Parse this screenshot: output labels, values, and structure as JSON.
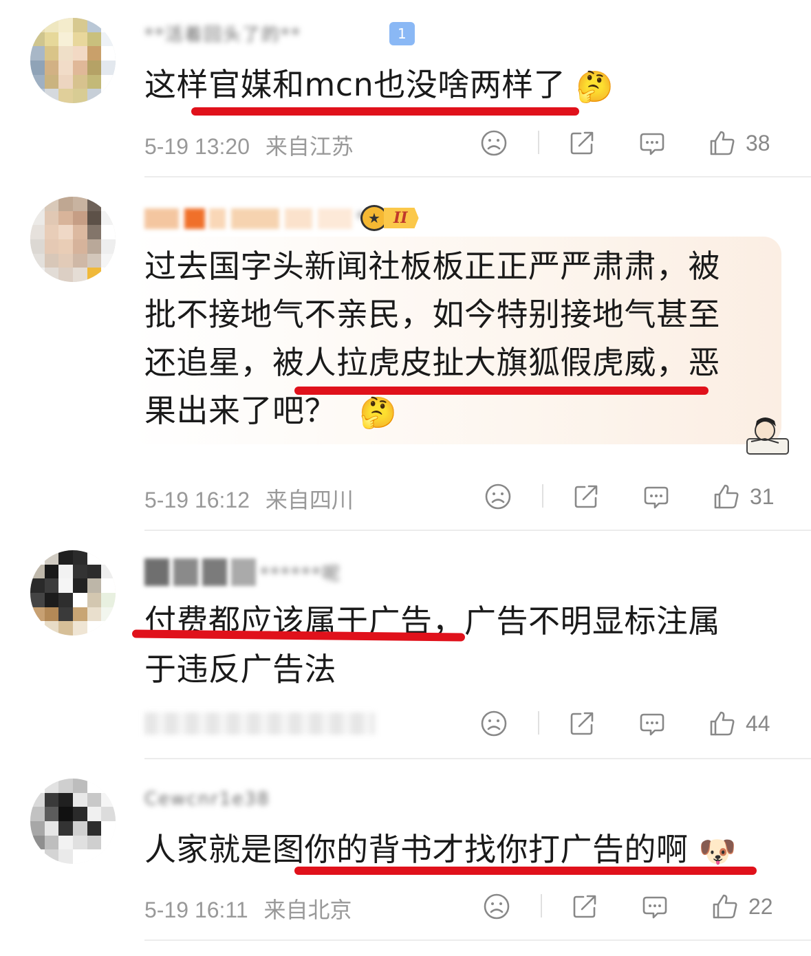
{
  "comments": [
    {
      "username": "**活着回头了的**",
      "level_badge": "1",
      "text_lines": [
        "这样官媒和mcn也没啥两样了"
      ],
      "emoji": "🤔",
      "time": "5-19 13:20",
      "location": "来自江苏",
      "likes": "38"
    },
    {
      "username": "****",
      "vip_badge": "II",
      "text_lines": [
        "过去国字头新闻社板板正正严严肃肃，被",
        "批不接地气不亲民，如今特别接地气甚至",
        "还追星，被人拉虎皮扯大旗狐假虎威，恶",
        "果出来了吧？"
      ],
      "emoji": "🤔",
      "time": "5-19 16:12",
      "location": "来自四川",
      "likes": "31"
    },
    {
      "username": "******呢",
      "text_lines": [
        "付费都应该属于广告，广告不明显标注属",
        "于违反广告法"
      ],
      "time": "",
      "location": "",
      "likes": "44"
    },
    {
      "username": "Cewcnr1e38",
      "text_lines": [
        "人家就是图你的背书才找你打广告的啊"
      ],
      "emoji": "🐶",
      "time": "5-19 16:11",
      "location": "来自北京",
      "likes": "22"
    }
  ],
  "icons": {
    "dislike": "sad-face-icon",
    "share": "share-icon",
    "comment": "comment-bubble-icon",
    "like": "thumbs-up-icon"
  },
  "colors": {
    "underline": "#e0111b",
    "meta_text": "#999999",
    "body_text": "#1a1a1a"
  }
}
